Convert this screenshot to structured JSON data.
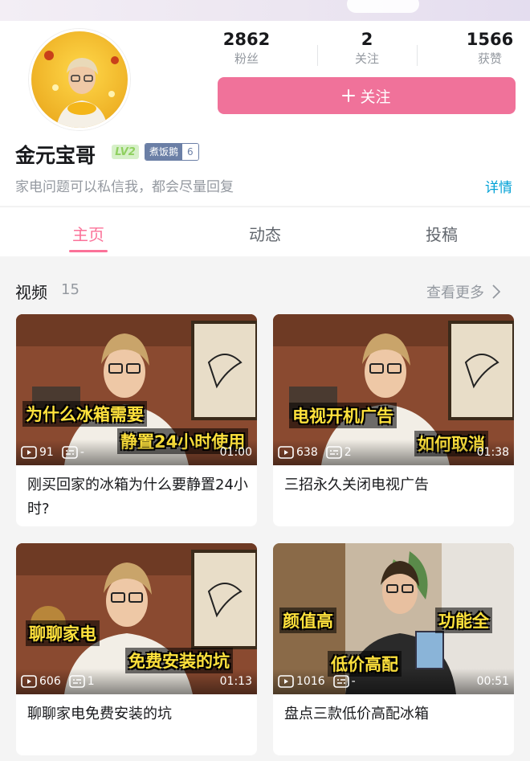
{
  "profile": {
    "name": "金元宝哥",
    "level": "LV2",
    "medal_name": "煮饭鹅",
    "medal_level": "6",
    "signature": "家电问题可以私信我，都会尽量回复",
    "detail_label": "详情",
    "follow_label": "关注",
    "stats": [
      {
        "value": "2862",
        "label": "粉丝"
      },
      {
        "value": "2",
        "label": "关注"
      },
      {
        "value": "1566",
        "label": "获赞"
      }
    ]
  },
  "tabs": [
    {
      "label": "主页"
    },
    {
      "label": "动态"
    },
    {
      "label": "投稿"
    }
  ],
  "section": {
    "title": "视频",
    "count": "15",
    "more_label": "查看更多"
  },
  "videos": [
    {
      "title": "刚买回家的冰箱为什么要静置24小时?",
      "plays": "91",
      "comments": "-",
      "duration": "01:00",
      "caption1": "为什么冰箱需要",
      "caption2": "静置24小时使用"
    },
    {
      "title": "三招永久关闭电视广告",
      "plays": "638",
      "comments": "2",
      "duration": "01:38",
      "caption1": "电视开机广告",
      "caption2": "如何取消"
    },
    {
      "title": "聊聊家电免费安装的坑",
      "plays": "606",
      "comments": "1",
      "duration": "01:13",
      "caption1": "聊聊家电",
      "caption2": "免费安装的坑"
    },
    {
      "title": "盘点三款低价高配冰箱",
      "plays": "1016",
      "comments": "-",
      "duration": "00:51",
      "caption1": "颜值高",
      "caption2": "功能全",
      "caption3": "低价高配"
    }
  ],
  "colors": {
    "accent": "#fb7299",
    "follow_button": "#f0729a",
    "link": "#00a1d6"
  }
}
